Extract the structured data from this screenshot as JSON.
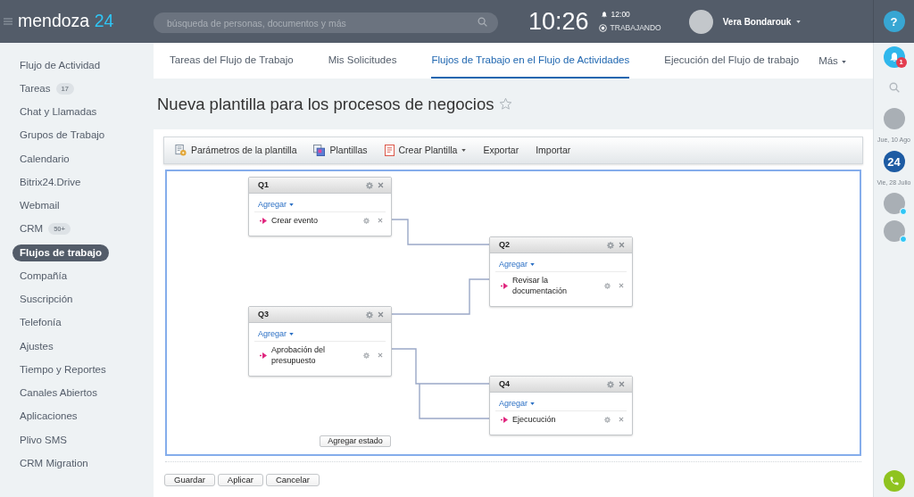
{
  "top_bar": {
    "logo": {
      "name": "mendoza",
      "suffix": "24"
    },
    "search": {
      "placeholder": "búsqueda de personas, documentos y más"
    },
    "clock": "10:26",
    "alarm": "12:00",
    "status": "TRABAJANDO",
    "user": {
      "name": "Vera Bondarouk"
    }
  },
  "sidebar": {
    "items": [
      {
        "label": "Flujo de Actividad",
        "selected": false
      },
      {
        "label": "Tareas",
        "counter": "17",
        "selected": false
      },
      {
        "label": "Chat y Llamadas",
        "selected": false
      },
      {
        "label": "Grupos de Trabajo",
        "selected": false
      },
      {
        "label": "Calendario",
        "selected": false
      },
      {
        "label": "Bitrix24.Drive",
        "selected": false
      },
      {
        "label": "Webmail",
        "selected": false
      },
      {
        "label": "CRM",
        "counter": "50+",
        "selected": false
      },
      {
        "label": "Flujos de trabajo",
        "selected": true
      },
      {
        "label": "Compañía",
        "selected": false
      },
      {
        "label": "Suscripción",
        "selected": false
      },
      {
        "label": "Telefonía",
        "selected": false
      },
      {
        "label": "Ajustes",
        "selected": false
      },
      {
        "label": "Tiempo y Reportes",
        "selected": false
      },
      {
        "label": "Canales Abiertos",
        "selected": false
      },
      {
        "label": "Aplicaciones",
        "selected": false
      },
      {
        "label": "Plivo SMS",
        "selected": false
      },
      {
        "label": "CRM Migration",
        "selected": false
      }
    ]
  },
  "tabs": [
    {
      "label": "Tareas del Flujo de Trabajo",
      "selected": false
    },
    {
      "label": "Mis Solicitudes",
      "selected": false
    },
    {
      "label": "Flujos de Trabajo en el Flujo de Actividades",
      "selected": true
    },
    {
      "label": "Ejecución del Flujo de trabajo",
      "selected": false
    }
  ],
  "more_tab": {
    "label": "Más"
  },
  "page": {
    "title": "Nueva plantilla para los procesos de negocios",
    "starred": false
  },
  "toolbar": [
    {
      "label": "Parámetros de la plantilla",
      "kind": "parameters",
      "menu": false
    },
    {
      "label": "Plantillas",
      "kind": "templates",
      "menu": false
    },
    {
      "label": "Crear Plantilla",
      "kind": "create",
      "menu": true
    },
    {
      "label": "Exportar",
      "kind": "plain",
      "menu": false
    },
    {
      "label": "Importar",
      "kind": "plain",
      "menu": false
    }
  ],
  "canvas": {
    "states": [
      {
        "title": "Q1",
        "add_label": "Agregar",
        "actions": [
          {
            "label": "Crear evento"
          }
        ]
      },
      {
        "title": "Q2",
        "add_label": "Agregar",
        "actions": [
          {
            "label": "Revisar la documentación"
          }
        ]
      },
      {
        "title": "Q3",
        "add_label": "Agregar",
        "actions": [
          {
            "label": "Aprobación del presupuesto"
          }
        ]
      },
      {
        "title": "Q4",
        "add_label": "Agregar",
        "actions": [
          {
            "label": "Ejecucución"
          }
        ]
      }
    ],
    "add_state": "Agregar estado"
  },
  "buttons": [
    "Guardar",
    "Aplicar",
    "Cancelar"
  ],
  "right_panel": {
    "help": "?",
    "notifications": {
      "count": "1"
    },
    "items": [
      {
        "kind": "photo",
        "online": false
      },
      {
        "kind": "date",
        "label": "Jue, 10 Ago"
      },
      {
        "kind": "logo",
        "label": "24"
      },
      {
        "kind": "date",
        "label": "Vie, 28 Julio"
      },
      {
        "kind": "photo",
        "online": true
      },
      {
        "kind": "photo",
        "online": true
      }
    ]
  }
}
